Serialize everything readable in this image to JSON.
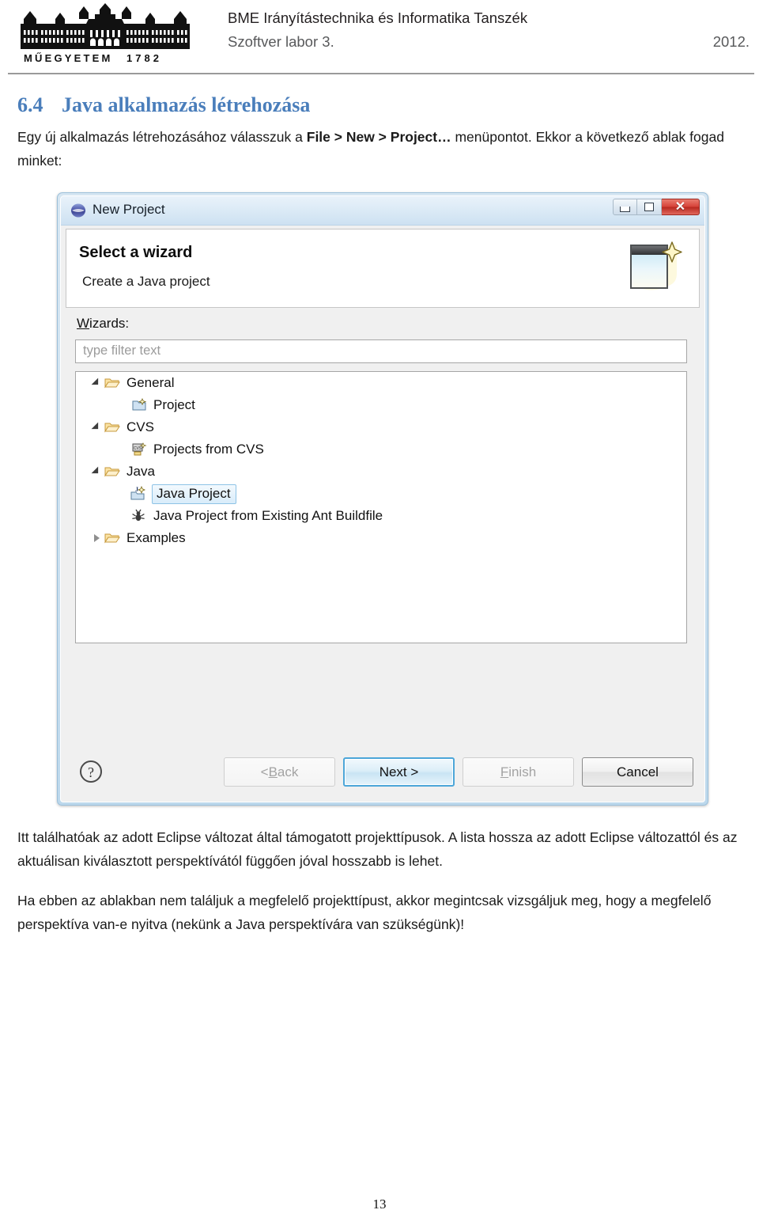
{
  "header": {
    "logo_caption": "M Ű E G Y E T E M   1 7 8 2",
    "department": "BME Irányítástechnika és Informatika Tanszék",
    "course": "Szoftver labor 3.",
    "year": "2012."
  },
  "section": {
    "number": "6.4",
    "title": "Java alkalmazás létrehozása",
    "intro_before": "Egy új alkalmazás létrehozásához válasszuk a ",
    "intro_bold": "File > New > Project…",
    "intro_after": " menüpontot. Ekkor a következő ablak fogad minket:"
  },
  "dialog": {
    "title": "New Project",
    "app_icon": "eclipse-sphere-icon",
    "window_buttons": {
      "minimize": "minimize-icon",
      "maximize": "maximize-icon",
      "close": "✕"
    },
    "banner": {
      "heading": "Select a wizard",
      "subtitle": "Create a Java project",
      "icon": "wizard-banner-icon"
    },
    "wizards_label_mnemonic": "W",
    "wizards_label_rest": "izards:",
    "filter": {
      "value": "",
      "placeholder": "type filter text"
    },
    "tree": [
      {
        "label": "General",
        "level": 0,
        "expanded": true,
        "icon": "folder-open-icon",
        "selected": false
      },
      {
        "label": "Project",
        "level": 1,
        "expanded": null,
        "icon": "project-wizard-icon",
        "selected": false
      },
      {
        "label": "CVS",
        "level": 0,
        "expanded": true,
        "icon": "folder-open-icon",
        "selected": false
      },
      {
        "label": "Projects from CVS",
        "level": 1,
        "expanded": null,
        "icon": "cvs-wizard-icon",
        "selected": false
      },
      {
        "label": "Java",
        "level": 0,
        "expanded": true,
        "icon": "folder-open-icon",
        "selected": false
      },
      {
        "label": "Java Project",
        "level": 1,
        "expanded": null,
        "icon": "java-project-icon",
        "selected": true
      },
      {
        "label": "Java Project from Existing Ant Buildfile",
        "level": 1,
        "expanded": null,
        "icon": "ant-buildfile-icon",
        "selected": false
      },
      {
        "label": "Examples",
        "level": 0,
        "expanded": false,
        "icon": "folder-open-icon",
        "selected": false
      }
    ],
    "buttons": {
      "help": "?",
      "back_prefix": "< ",
      "back_mnemonic": "B",
      "back_rest": "ack",
      "next": "Next >",
      "finish_mnemonic": "F",
      "finish_rest": "inish",
      "cancel": "Cancel"
    }
  },
  "paragraphs": {
    "p1": "Itt találhatóak az adott Eclipse változat által támogatott projekttípusok. A lista hossza az adott Eclipse változattól és az aktuálisan kiválasztott perspektívától függően jóval hosszabb is lehet.",
    "p2": "Ha ebben az ablakban nem találjuk a megfelelő projekttípust, akkor megintcsak vizsgáljuk meg, hogy a megfelelő perspektíva van-e nyitva (nekünk a Java perspektívára van szükségünk)!"
  },
  "footer": {
    "page_number": "13"
  },
  "colors": {
    "heading_blue": "#4a7ebb",
    "close_red": "#d7433a",
    "default_button_border": "#4ca6d9",
    "selection_blue": "#8ec3e6"
  }
}
